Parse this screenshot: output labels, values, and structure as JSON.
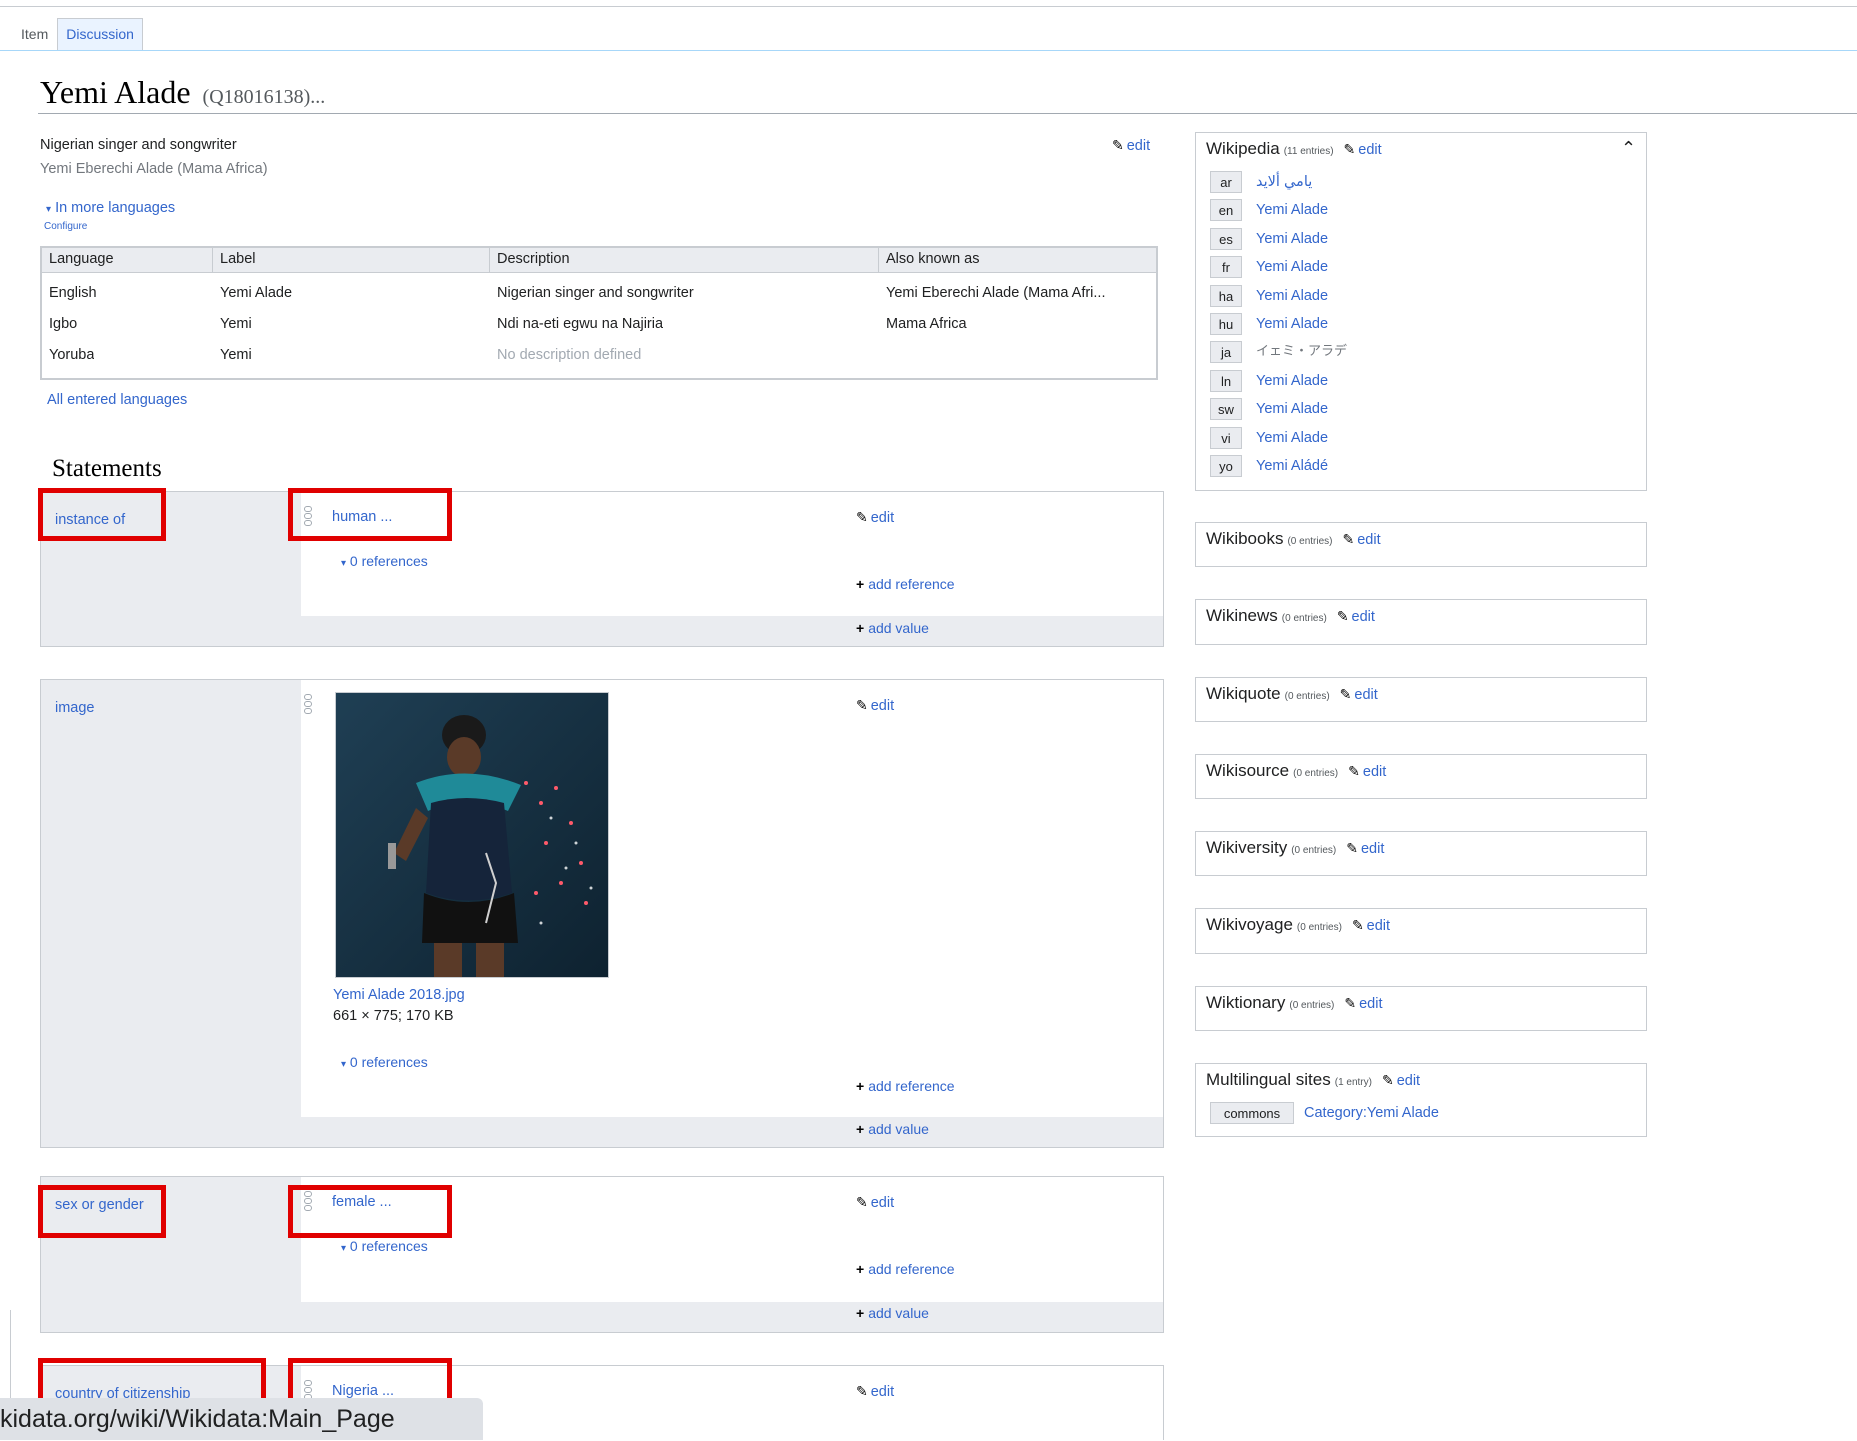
{
  "tabs": [
    "Item",
    "Discussion"
  ],
  "title": {
    "label": "Yemi Alade",
    "qid": "(Q18016138)",
    "more": "..."
  },
  "header": {
    "description": "Nigerian singer and songwriter",
    "aliases": "Yemi Eberechi Alade (Mama Africa)",
    "edit": "edit",
    "more_languages": "In more languages",
    "configure": "Configure",
    "all_languages": "All entered languages"
  },
  "lang_table": {
    "columns": [
      "Language",
      "Label",
      "Description",
      "Also known as"
    ],
    "rows": [
      {
        "language": "English",
        "label": "Yemi Alade",
        "description": "Nigerian singer and songwriter",
        "aliases": "Yemi Eberechi Alade (Mama Afri..."
      },
      {
        "language": "Igbo",
        "label": "Yemi",
        "description": "Ndi na-eti egwu na Najiria",
        "aliases": "Mama Africa"
      },
      {
        "language": "Yoruba",
        "label": "Yemi",
        "description": "No description defined",
        "aliases": ""
      }
    ]
  },
  "statements": {
    "heading": "Statements",
    "edit": "edit",
    "add_reference": "add reference",
    "add_value": "add value",
    "references": "0 references",
    "items": [
      {
        "property": "instance of",
        "value": "human ..."
      },
      {
        "property": "image",
        "value": "",
        "file_name": "Yemi Alade 2018.jpg",
        "file_info": "661 × 775; 170 KB"
      },
      {
        "property": "sex or gender",
        "value": "female ..."
      },
      {
        "property": "country of citizenship",
        "value": "Nigeria ..."
      }
    ]
  },
  "sitelinks": {
    "edit": "edit",
    "wikipedia": {
      "name": "Wikipedia",
      "count": "(11 entries)",
      "entries": [
        {
          "code": "ar",
          "title": "يامي ألايد"
        },
        {
          "code": "en",
          "title": "Yemi Alade"
        },
        {
          "code": "es",
          "title": "Yemi Alade"
        },
        {
          "code": "fr",
          "title": "Yemi Alade"
        },
        {
          "code": "ha",
          "title": "Yemi Alade"
        },
        {
          "code": "hu",
          "title": "Yemi Alade"
        },
        {
          "code": "ja",
          "title": "イェミ・アラデ"
        },
        {
          "code": "ln",
          "title": "Yemi Alade"
        },
        {
          "code": "sw",
          "title": "Yemi Alade"
        },
        {
          "code": "vi",
          "title": "Yemi Alade"
        },
        {
          "code": "yo",
          "title": "Yemi Aládé"
        }
      ]
    },
    "groups": [
      {
        "name": "Wikibooks",
        "count": "(0 entries)"
      },
      {
        "name": "Wikinews",
        "count": "(0 entries)"
      },
      {
        "name": "Wikiquote",
        "count": "(0 entries)"
      },
      {
        "name": "Wikisource",
        "count": "(0 entries)"
      },
      {
        "name": "Wikiversity",
        "count": "(0 entries)"
      },
      {
        "name": "Wikivoyage",
        "count": "(0 entries)"
      },
      {
        "name": "Wiktionary",
        "count": "(0 entries)"
      }
    ],
    "multilingual": {
      "name": "Multilingual sites",
      "count": "(1 entry)",
      "code": "commons",
      "title": "Category:Yemi Alade"
    }
  },
  "status_url": "kidata.org/wiki/Wikidata:Main_Page",
  "colors": {
    "link": "#3366cc",
    "highlight": "#e00000",
    "panel": "#eaecf0"
  }
}
